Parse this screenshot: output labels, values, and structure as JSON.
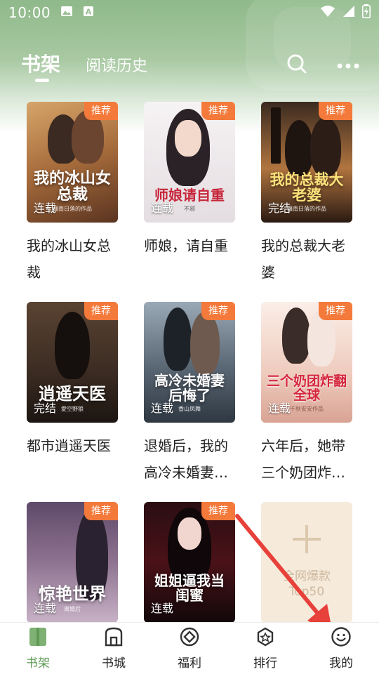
{
  "status_bar": {
    "time": "10:00"
  },
  "header": {
    "tabs": [
      {
        "label": "书架",
        "active": true
      },
      {
        "label": "阅读历史",
        "active": false
      }
    ],
    "icons": [
      "search-icon",
      "more-icon"
    ]
  },
  "books": [
    {
      "name": "我的冰山女总裁",
      "badge": "推荐",
      "state": "连载",
      "cover_title": "我的冰山女总裁",
      "cover_author": "疆南日落的作品",
      "colors": [
        "#7a4a2c",
        "#c9935b"
      ]
    },
    {
      "name": "师娘，请自重",
      "badge": "推荐",
      "state": "连载",
      "cover_title": "师娘请自重",
      "cover_author": "不邪",
      "colors": [
        "#f1ecee",
        "#d8cfd6"
      ]
    },
    {
      "name": "我的总裁大老婆",
      "badge": "推荐",
      "state": "完结",
      "cover_title": "我的总裁大老婆",
      "cover_author": "疆南日落的作品",
      "colors": [
        "#2b1b14",
        "#a5693b"
      ]
    },
    {
      "name": "都市逍遥天医",
      "badge": "推荐",
      "state": "完结",
      "cover_title": "逍遥天医",
      "cover_author": "愛空野狼",
      "colors": [
        "#2a1f1a",
        "#6f5441"
      ]
    },
    {
      "name": "退婚后，我的高冷未婚妻…",
      "badge": "推荐",
      "state": "连载",
      "cover_title": "高冷未婚妻后悔了",
      "cover_author": "香山凤舞",
      "colors": [
        "#3f4a56",
        "#8a9aa8"
      ]
    },
    {
      "name": "六年后，她带三个奶团炸…",
      "badge": "推荐",
      "state": "连载",
      "cover_title": "三个奶团炸翻全球",
      "cover_author": "千秋安安作品",
      "colors": [
        "#f2d9cf",
        "#c98b7a"
      ]
    },
    {
      "name": "",
      "badge": "推荐",
      "state": "连载",
      "cover_title": "惊艳世界",
      "cover_author": "离婚后",
      "colors": [
        "#4a3a5a",
        "#b59ab6"
      ]
    },
    {
      "name": "",
      "badge": "推荐",
      "state": "连载",
      "cover_title": "姐姐逼我当闺蜜",
      "cover_author": "",
      "colors": [
        "#1a0a0d",
        "#8a2530"
      ]
    }
  ],
  "placeholder": {
    "line1": "全网爆款",
    "line2": "Top50"
  },
  "bottom_nav": [
    {
      "label": "书架",
      "icon": "bookshelf-icon",
      "active": true
    },
    {
      "label": "书城",
      "icon": "store-icon",
      "active": false
    },
    {
      "label": "福利",
      "icon": "gift-icon",
      "active": false
    },
    {
      "label": "排行",
      "icon": "rank-icon",
      "active": false
    },
    {
      "label": "我的",
      "icon": "profile-icon",
      "active": false
    }
  ],
  "accent_color": "#5f9a55",
  "badge_color": "#f47a3b",
  "annotation_arrow_color": "#e8403a"
}
